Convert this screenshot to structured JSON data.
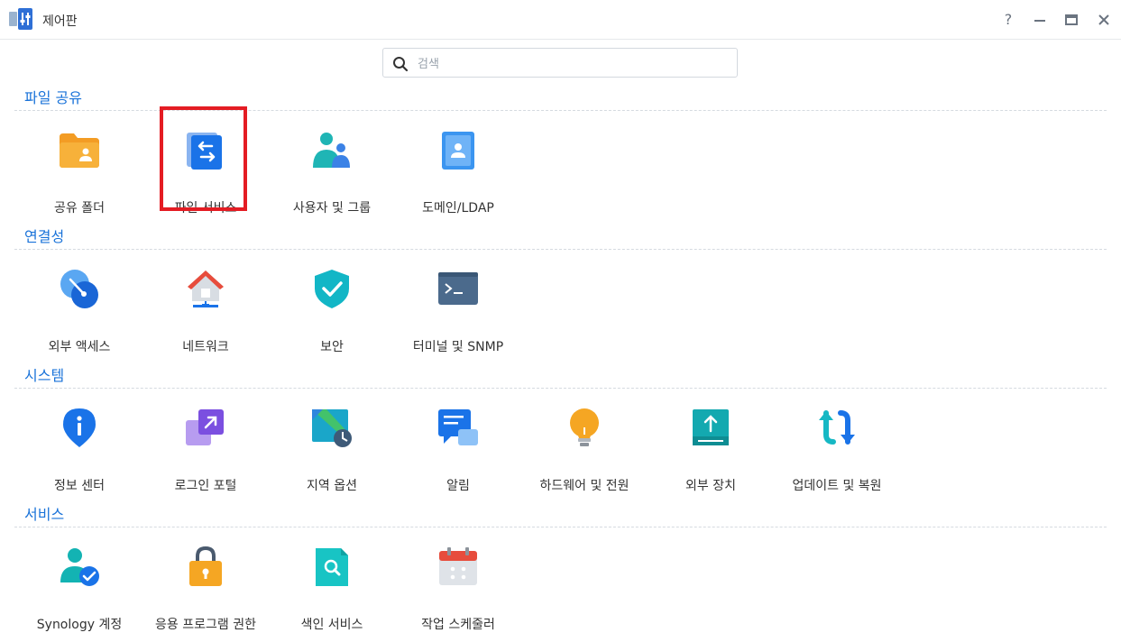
{
  "window": {
    "title": "제어판",
    "buttons": {
      "help": "?",
      "minimize": "–",
      "maximize": "▭",
      "close": "✕"
    }
  },
  "search": {
    "placeholder": "검색",
    "value": ""
  },
  "categories": [
    {
      "title": "파일 공유",
      "items": [
        {
          "label": "공유 폴더",
          "icon": "shared-folder-icon"
        },
        {
          "label": "파일 서비스",
          "icon": "file-services-icon"
        },
        {
          "label": "사용자 및 그룹",
          "icon": "users-groups-icon"
        },
        {
          "label": "도메인/LDAP",
          "icon": "domain-ldap-icon"
        }
      ]
    },
    {
      "title": "연결성",
      "items": [
        {
          "label": "외부 액세스",
          "icon": "external-access-icon"
        },
        {
          "label": "네트워크",
          "icon": "network-icon"
        },
        {
          "label": "보안",
          "icon": "security-icon"
        },
        {
          "label": "터미널 및 SNMP",
          "icon": "terminal-snmp-icon"
        }
      ]
    },
    {
      "title": "시스템",
      "items": [
        {
          "label": "정보 센터",
          "icon": "info-center-icon"
        },
        {
          "label": "로그인 포털",
          "icon": "login-portal-icon"
        },
        {
          "label": "지역 옵션",
          "icon": "regional-options-icon"
        },
        {
          "label": "알림",
          "icon": "notification-icon"
        },
        {
          "label": "하드웨어 및 전원",
          "icon": "hardware-power-icon"
        },
        {
          "label": "외부 장치",
          "icon": "external-devices-icon"
        },
        {
          "label": "업데이트 및 복원",
          "icon": "update-restore-icon"
        }
      ]
    },
    {
      "title": "서비스",
      "items": [
        {
          "label": "Synology 계정",
          "icon": "synology-account-icon"
        },
        {
          "label": "응용 프로그램 권한",
          "icon": "app-privileges-icon"
        },
        {
          "label": "색인 서비스",
          "icon": "indexing-service-icon"
        },
        {
          "label": "작업 스케줄러",
          "icon": "task-scheduler-icon"
        }
      ]
    }
  ],
  "highlighted_item": "파일 서비스",
  "colors": {
    "accent": "#1a73d9",
    "highlight_border": "#e41c23"
  }
}
